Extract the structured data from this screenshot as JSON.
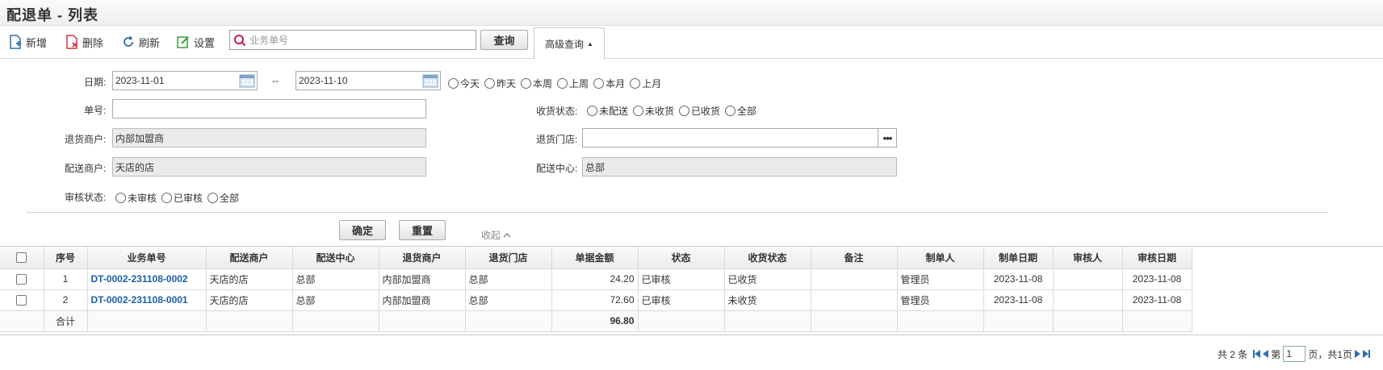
{
  "page": {
    "title": "配退单 - 列表"
  },
  "toolbar": {
    "add_label": "新增",
    "delete_label": "删除",
    "refresh_label": "刷新",
    "settings_label": "设置",
    "search_placeholder": "业务单号",
    "query_label": "查询",
    "advanced_label": "高级查询"
  },
  "form": {
    "date_label": "日期:",
    "date_from": "2023-11-01",
    "date_sep": "--",
    "date_to": "2023-11-10",
    "date_shortcuts": [
      "今天",
      "昨天",
      "本周",
      "上周",
      "本月",
      "上月"
    ],
    "number_label": "单号:",
    "number_value": "",
    "receive_status_label": "收货状态:",
    "receive_status_options": [
      "未配送",
      "未收货",
      "已收货",
      "全部"
    ],
    "return_merchant_label": "退货商户:",
    "return_merchant_value": "内部加盟商",
    "return_store_label": "退货门店:",
    "return_store_value": "",
    "dispatch_merchant_label": "配送商户:",
    "dispatch_merchant_value": "天店的店",
    "dispatch_center_label": "配送中心:",
    "dispatch_center_value": "总部",
    "audit_status_label": "审核状态:",
    "audit_status_options": [
      "未审核",
      "已审核",
      "全部"
    ],
    "confirm_label": "确定",
    "reset_label": "重置",
    "collapse_label": "收起"
  },
  "grid": {
    "columns": [
      "序号",
      "业务单号",
      "配送商户",
      "配送中心",
      "退货商户",
      "退货门店",
      "单据金额",
      "状态",
      "收货状态",
      "备注",
      "制单人",
      "制单日期",
      "审核人",
      "审核日期"
    ],
    "rows": [
      {
        "seq": "1",
        "doc_no": "DT-0002-231108-0002",
        "dispatch_merchant": "天店的店",
        "dispatch_center": "总部",
        "return_merchant": "内部加盟商",
        "return_store": "总部",
        "amount": "24.20",
        "status": "已审核",
        "receive_status": "已收货",
        "remark": "",
        "creator": "管理员",
        "create_date": "2023-11-08",
        "auditor": "",
        "audit_date": "2023-11-08"
      },
      {
        "seq": "2",
        "doc_no": "DT-0002-231108-0001",
        "dispatch_merchant": "天店的店",
        "dispatch_center": "总部",
        "return_merchant": "内部加盟商",
        "return_store": "总部",
        "amount": "72.60",
        "status": "已审核",
        "receive_status": "未收货",
        "remark": "",
        "creator": "管理员",
        "create_date": "2023-11-08",
        "auditor": "",
        "audit_date": "2023-11-08"
      }
    ],
    "summary": {
      "label": "合计",
      "amount": "96.80"
    }
  },
  "pager": {
    "total_text": "共 2 条",
    "page_prefix": "第",
    "page_value": "1",
    "page_suffix": "页，共1页"
  },
  "colors": {
    "link": "#1a5fa8",
    "accent_red": "#d9333f",
    "accent_blue": "#2f6ea8",
    "accent_green": "#3a9a3a"
  }
}
